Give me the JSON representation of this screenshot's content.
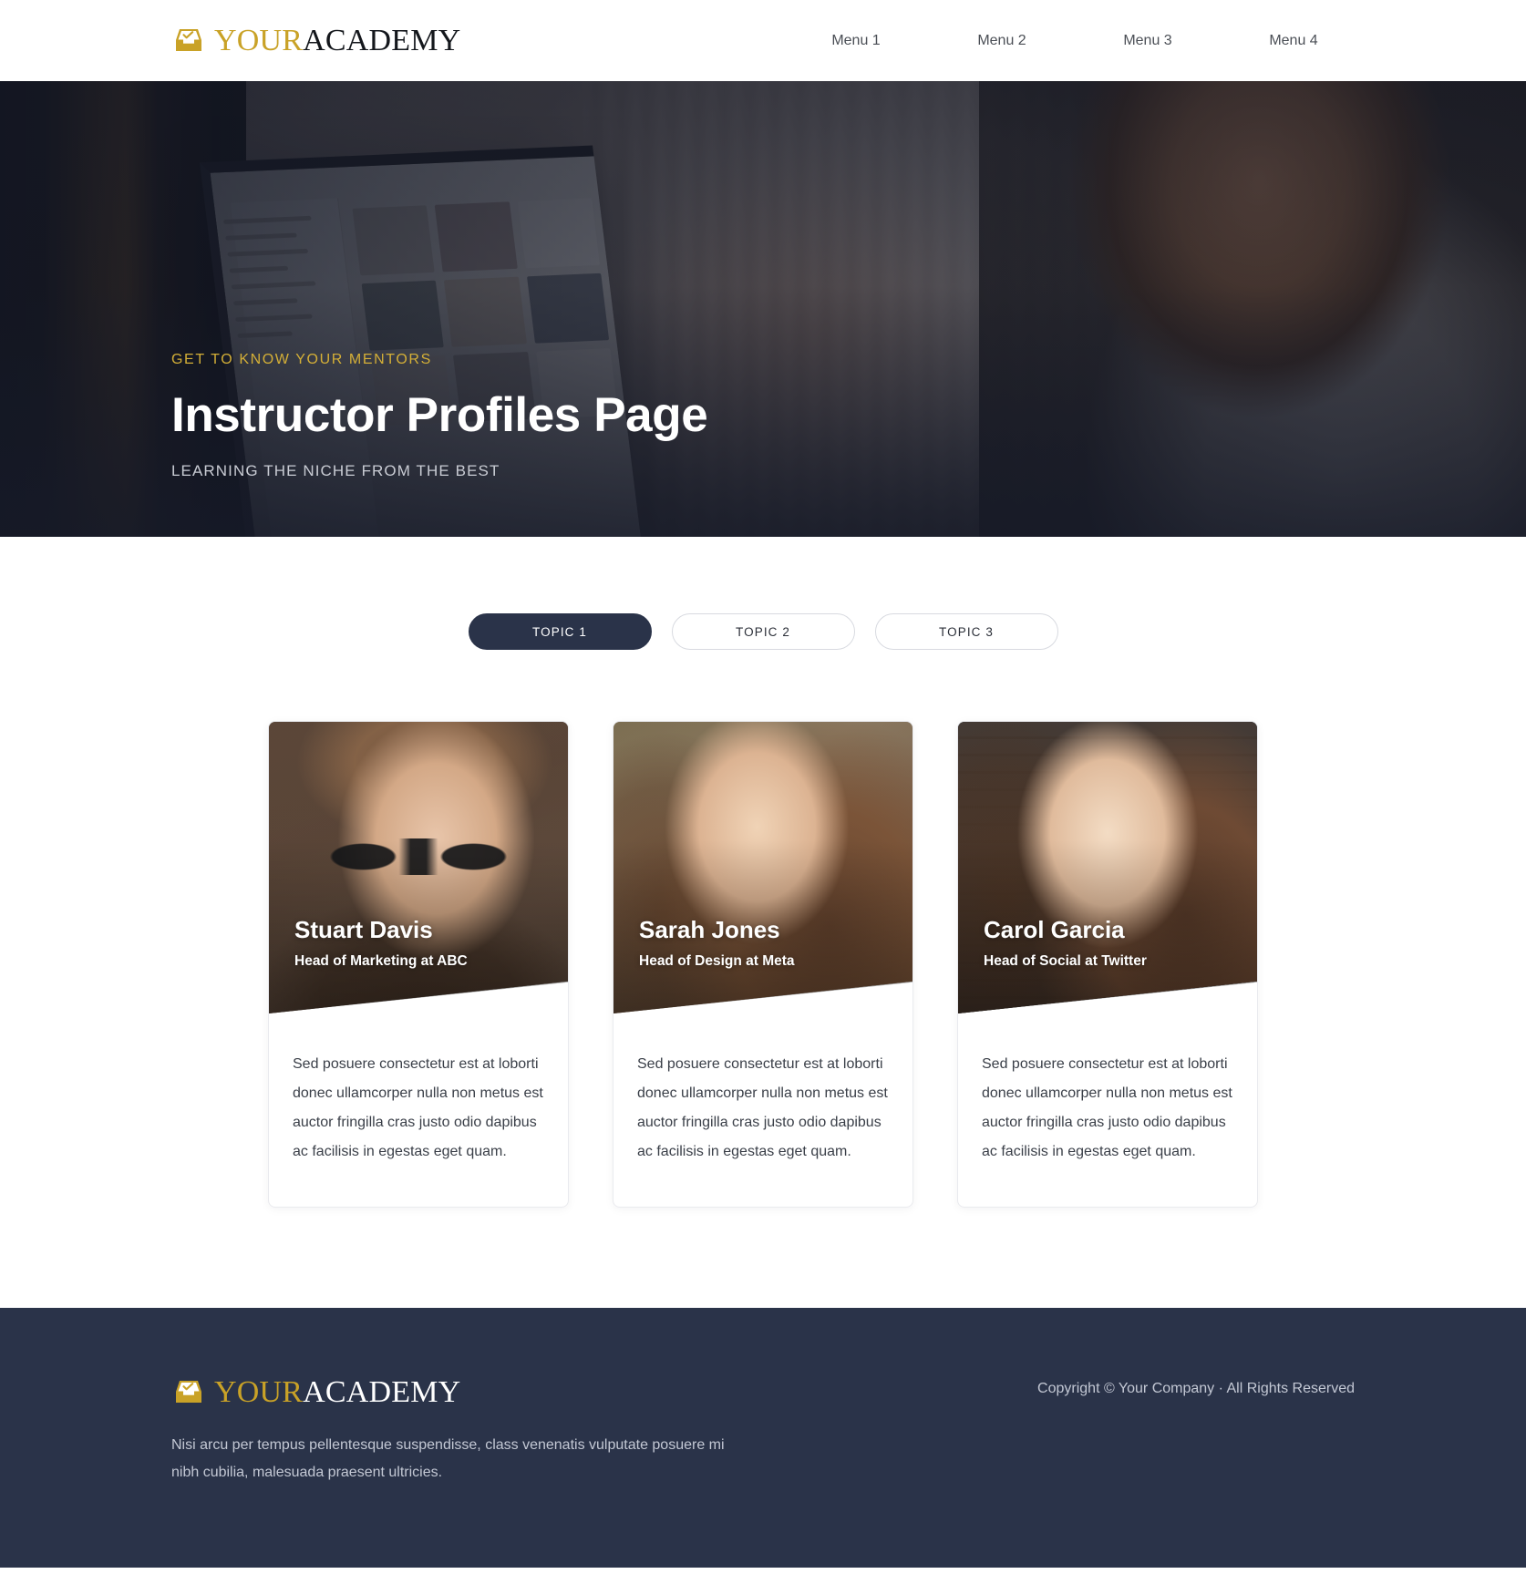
{
  "header": {
    "brand": {
      "first": "YOUR",
      "second": "ACADEMY",
      "icon": "inbox-check-icon"
    },
    "nav": [
      {
        "label": "Menu 1"
      },
      {
        "label": "Menu 2"
      },
      {
        "label": "Menu 3"
      },
      {
        "label": "Menu 4"
      }
    ]
  },
  "hero": {
    "eyebrow": "GET TO KNOW YOUR MENTORS",
    "title": "Instructor Profiles Page",
    "subtitle": "LEARNING THE NICHE FROM THE BEST"
  },
  "tabs": [
    {
      "label": "TOPIC 1",
      "active": true
    },
    {
      "label": "TOPIC 2",
      "active": false
    },
    {
      "label": "TOPIC 3",
      "active": false
    }
  ],
  "instructors": [
    {
      "name": "Stuart Davis",
      "role": "Head of Marketing at ABC",
      "bio": "Sed posuere consectetur est at loborti donec ullamcorper nulla non metus est auctor fringilla cras justo odio dapibus ac facilisis in egestas eget quam."
    },
    {
      "name": "Sarah Jones",
      "role": "Head of Design at Meta",
      "bio": "Sed posuere consectetur est at loborti donec ullamcorper nulla non metus est auctor fringilla cras justo odio dapibus ac facilisis in egestas eget quam."
    },
    {
      "name": "Carol Garcia",
      "role": "Head of Social at Twitter",
      "bio": "Sed posuere consectetur est at loborti donec ullamcorper nulla non metus est auctor fringilla cras justo odio dapibus ac facilisis in egestas eget quam."
    }
  ],
  "footer": {
    "brand": {
      "first": "YOUR",
      "second": "ACADEMY",
      "icon": "inbox-check-icon"
    },
    "note": "Nisi arcu per tempus pellentesque suspendisse, class venenatis vulputate posuere mi nibh cubilia, malesuada praesent ultricies.",
    "copyright": "Copyright © Your Company · All Rights Reserved"
  },
  "colors": {
    "gold": "#c9a227",
    "accent_gold": "#d4af37",
    "navy": "#2a3349",
    "body_text": "#3a3f48"
  }
}
